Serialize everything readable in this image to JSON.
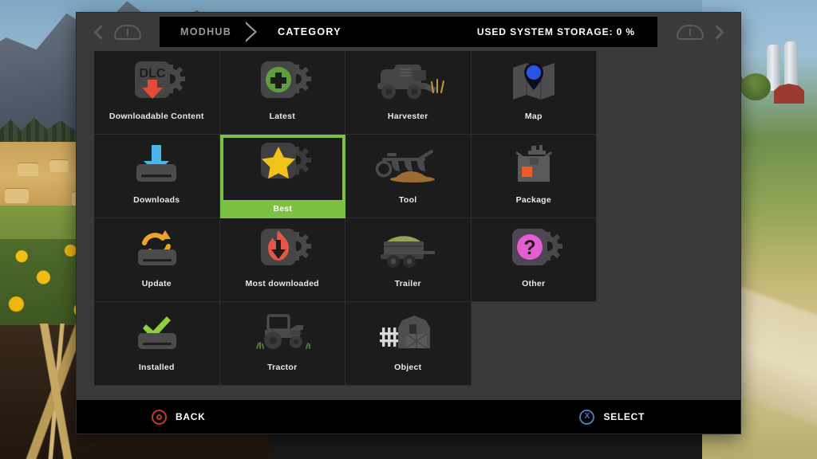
{
  "window": {
    "header": {
      "breadcrumbs": [
        {
          "label": "MODHUB",
          "active": false
        },
        {
          "label": "CATEGORY",
          "active": true
        }
      ],
      "storage_text": "USED SYSTEM STORAGE: 0 %",
      "left_nav": {
        "prev_icon": "chevron-left-icon",
        "bumper_icon": "left-bumper-icon"
      },
      "right_nav": {
        "bumper_icon": "right-bumper-icon",
        "next_icon": "chevron-right-icon"
      }
    },
    "grid": {
      "columns": 4,
      "items": [
        {
          "label": "Downloadable Content",
          "icon": "dlc-gear-icon",
          "selected": false
        },
        {
          "label": "Latest",
          "icon": "plus-gear-icon",
          "selected": false
        },
        {
          "label": "Harvester",
          "icon": "harvester-icon",
          "selected": false
        },
        {
          "label": "Map",
          "icon": "map-pin-icon",
          "selected": false
        },
        {
          "label": "Downloads",
          "icon": "download-drive-icon",
          "selected": false
        },
        {
          "label": "Best",
          "icon": "star-gear-icon",
          "selected": true
        },
        {
          "label": "Tool",
          "icon": "plow-icon",
          "selected": false
        },
        {
          "label": "Package",
          "icon": "open-box-icon",
          "selected": false
        },
        {
          "label": "Update",
          "icon": "refresh-drive-icon",
          "selected": false
        },
        {
          "label": "Most downloaded",
          "icon": "flame-download-gear-icon",
          "selected": false
        },
        {
          "label": "Trailer",
          "icon": "trailer-icon",
          "selected": false
        },
        {
          "label": "Other",
          "icon": "question-gear-icon",
          "selected": false
        },
        {
          "label": "Installed",
          "icon": "check-drive-icon",
          "selected": false
        },
        {
          "label": "Tractor",
          "icon": "tractor-icon",
          "selected": false
        },
        {
          "label": "Object",
          "icon": "barn-fence-icon",
          "selected": false
        }
      ]
    },
    "footer": {
      "back": {
        "label": "BACK",
        "glyph": "circle",
        "glyph_color": "#c0392b"
      },
      "select": {
        "label": "SELECT",
        "glyph": "X",
        "glyph_color": "#4a76b8"
      }
    }
  },
  "colors": {
    "selection_green": "#7cc142",
    "panel_bg": "#3a3a3a",
    "cell_bg": "#1c1c1c",
    "header_bar": "#000000"
  }
}
